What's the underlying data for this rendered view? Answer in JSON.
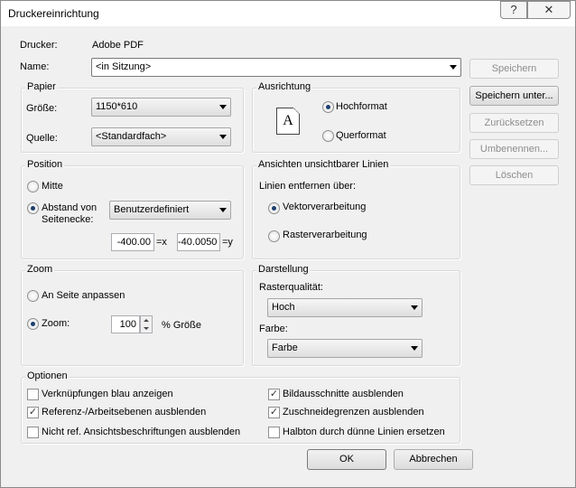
{
  "window": {
    "title": "Druckereinrichtung",
    "help": "?",
    "close": "✕"
  },
  "printer": {
    "label": "Drucker:",
    "value": "Adobe PDF"
  },
  "name": {
    "label": "Name:",
    "value": "<in Sitzung>"
  },
  "side_buttons": {
    "save": "Speichern",
    "save_as": "Speichern unter...",
    "reset": "Zurücksetzen",
    "rename": "Umbenennen...",
    "delete": "Löschen"
  },
  "paper": {
    "title": "Papier",
    "size_label": "Größe:",
    "size_value": "1150*610",
    "source_label": "Quelle:",
    "source_value": "<Standardfach>"
  },
  "orientation": {
    "title": "Ausrichtung",
    "icon_letter": "A",
    "portrait": "Hochformat",
    "landscape": "Querformat",
    "selected": "portrait"
  },
  "position": {
    "title": "Position",
    "center": "Mitte",
    "offset_line1": "Abstand von",
    "offset_line2": "Seitenecke:",
    "offset_mode": "Benutzerdefiniert",
    "x_value": "-400.00",
    "x_unit": "=x",
    "y_value": "-40.0050",
    "y_unit": "=y",
    "selected": "offset"
  },
  "hidden_lines": {
    "title": "Ansichten unsichtbarer Linien",
    "remove_label": "Linien entfernen über:",
    "vector": "Vektorverarbeitung",
    "raster": "Rasterverarbeitung",
    "selected": "vector"
  },
  "zoom": {
    "title": "Zoom",
    "fit": "An Seite anpassen",
    "zoom_label": "Zoom:",
    "zoom_value": "100",
    "unit": "% Größe",
    "selected": "zoom"
  },
  "display": {
    "title": "Darstellung",
    "raster_quality_label": "Rasterqualität:",
    "raster_quality_value": "Hoch",
    "color_label": "Farbe:",
    "color_value": "Farbe"
  },
  "options": {
    "title": "Optionen",
    "items": [
      {
        "label": "Verknüpfungen blau anzeigen",
        "checked": false
      },
      {
        "label": "Referenz-/Arbeitsebenen ausblenden",
        "checked": true
      },
      {
        "label": "Nicht ref. Ansichtsbeschriftungen ausblenden",
        "checked": false
      },
      {
        "label": "Bildausschnitte ausblenden",
        "checked": true
      },
      {
        "label": "Zuschneidegrenzen ausblenden",
        "checked": true
      },
      {
        "label": "Halbton durch dünne Linien ersetzen",
        "checked": false
      }
    ]
  },
  "footer": {
    "ok": "OK",
    "cancel": "Abbrechen"
  },
  "colors": {
    "window_bg": "#f0f0f0",
    "radio_dot": "#1c3f6e",
    "disabled_text": "#8d8d8d"
  }
}
